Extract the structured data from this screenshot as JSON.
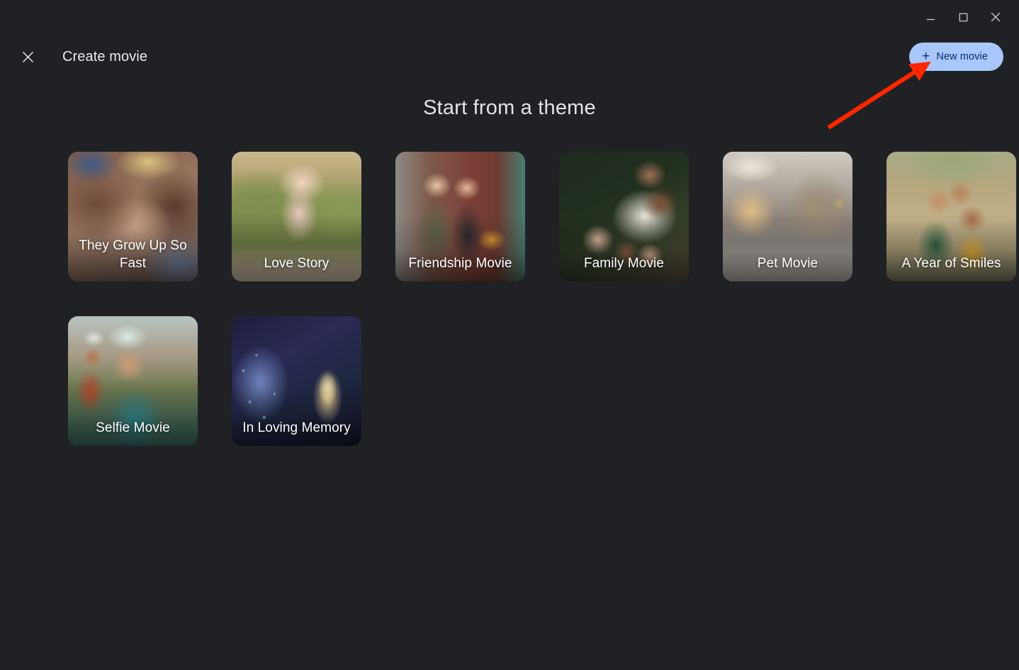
{
  "window": {
    "controls": [
      {
        "name": "minimize",
        "label": "Minimize"
      },
      {
        "name": "maximize",
        "label": "Maximize"
      },
      {
        "name": "close",
        "label": "Close"
      }
    ]
  },
  "header": {
    "close_icon": "close-icon",
    "title": "Create movie",
    "new_movie_button": {
      "plus": "+",
      "label": "New movie",
      "bg_color": "#a8c7fa",
      "text_color": "#062e6f"
    }
  },
  "main": {
    "section_title": "Start from a theme",
    "themes": [
      {
        "label": "They Grow Up So Fast",
        "art": "art-grow"
      },
      {
        "label": "Love Story",
        "art": "art-love"
      },
      {
        "label": "Friendship Movie",
        "art": "art-friend"
      },
      {
        "label": "Family Movie",
        "art": "art-family"
      },
      {
        "label": "Pet Movie",
        "art": "art-pet"
      },
      {
        "label": "A Year of Smiles",
        "art": "art-year"
      },
      {
        "label": "Selfie Movie",
        "art": "art-selfie"
      },
      {
        "label": "In Loving Memory",
        "art": "art-memory"
      }
    ]
  },
  "annotation": {
    "arrow_color": "#ff2600",
    "points_to": "new-movie-button"
  },
  "theme": {
    "background": "#202124",
    "text_primary": "#e8eaed"
  }
}
